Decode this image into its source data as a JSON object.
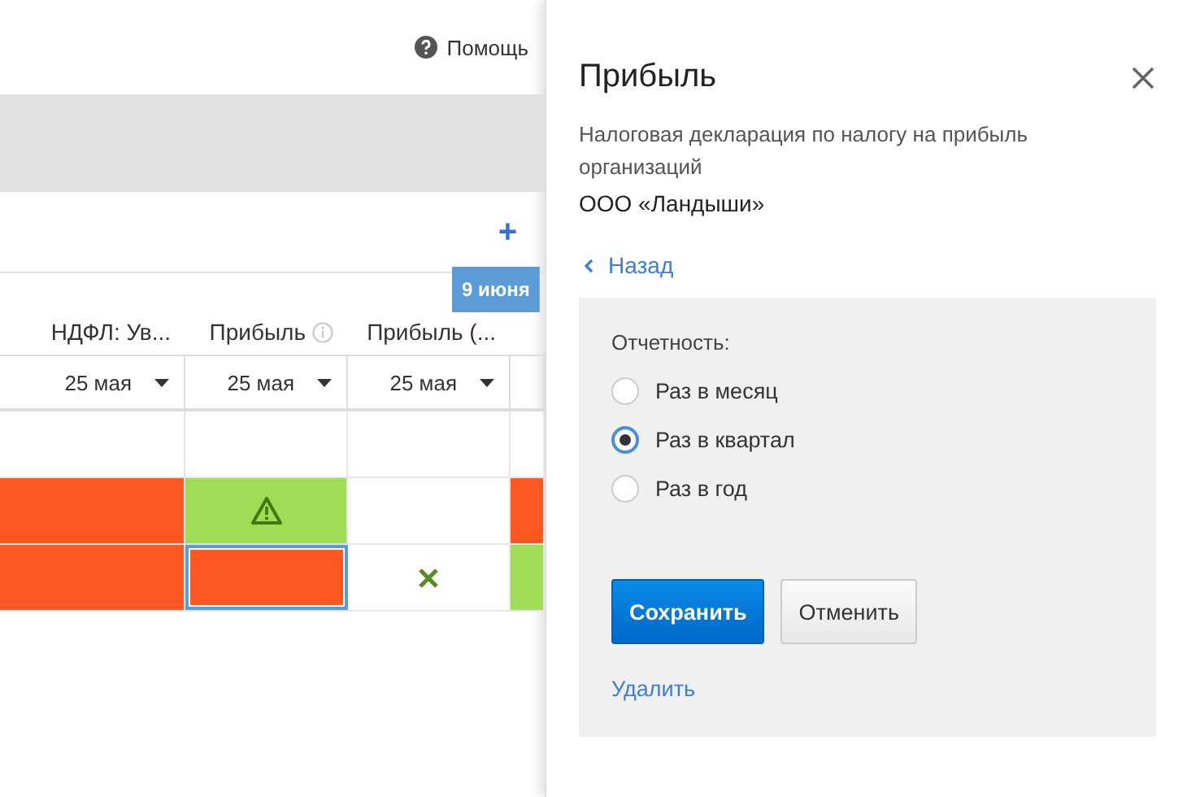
{
  "header": {
    "help": "Помощь"
  },
  "toolbar": {
    "add": "+"
  },
  "badge": "9 июня",
  "columns": [
    {
      "header": "НДФЛ: Ув...",
      "info": false,
      "date": "25 мая"
    },
    {
      "header": "Прибыль",
      "info": true,
      "date": "25 мая"
    },
    {
      "header": "Прибыль (...",
      "info": false,
      "date": "25 мая"
    }
  ],
  "rows": [
    [
      {
        "kind": "empty",
        "selected": false
      },
      {
        "kind": "empty",
        "selected": false
      },
      {
        "kind": "empty",
        "selected": false
      },
      {
        "kind": "empty",
        "selected": false
      }
    ],
    [
      {
        "kind": "overdue",
        "selected": false
      },
      {
        "kind": "done-warning",
        "selected": false
      },
      {
        "kind": "empty",
        "selected": false
      },
      {
        "kind": "overdue",
        "selected": false
      }
    ],
    [
      {
        "kind": "overdue",
        "selected": false
      },
      {
        "kind": "overdue",
        "selected": true
      },
      {
        "kind": "empty-cross",
        "selected": false
      },
      {
        "kind": "done",
        "selected": false
      }
    ]
  ],
  "panel": {
    "title": "Прибыль",
    "subtitle": "Налоговая декларация по налогу на прибыль организаций",
    "company": "ООО «Ландыши»",
    "back": "Назад",
    "form": {
      "label": "Отчетность:",
      "options": [
        {
          "label": "Раз в месяц",
          "selected": false
        },
        {
          "label": "Раз в квартал",
          "selected": true
        },
        {
          "label": "Раз в год",
          "selected": false
        }
      ],
      "save": "Сохранить",
      "cancel": "Отменить",
      "delete": "Удалить"
    }
  }
}
